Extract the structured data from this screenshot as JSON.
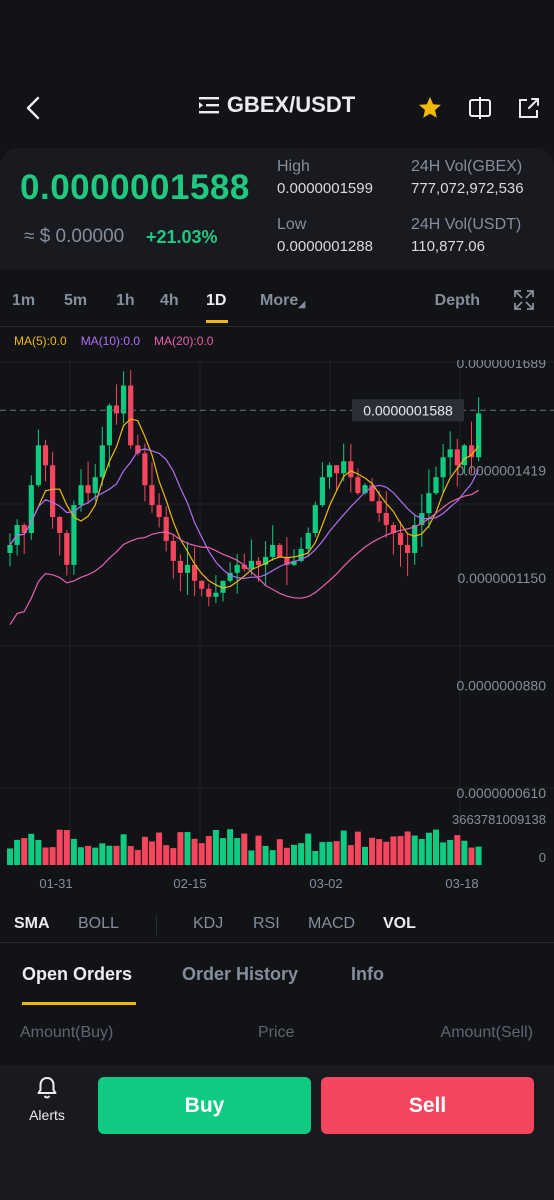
{
  "header": {
    "pair": "GBEX/USDT",
    "icons": [
      "back-arrow-icon",
      "list-icon",
      "star-icon",
      "split-icon",
      "share-icon"
    ],
    "star_color": "#f0b90b"
  },
  "summary": {
    "price": "0.0000001588",
    "usd_value": "≈ $ 0.00000",
    "change": "+21.03%",
    "high_label": "High",
    "high_value": "0.0000001599",
    "low_label": "Low",
    "low_value": "0.0000001288",
    "vol_base_label": "24H Vol(GBEX)",
    "vol_base_value": "777,072,972,536",
    "vol_quote_label": "24H Vol(USDT)",
    "vol_quote_value": "110,877.06"
  },
  "intervals": {
    "items": [
      "1m",
      "5m",
      "1h",
      "4h",
      "1D",
      "More"
    ],
    "active": "1D",
    "depth": "Depth"
  },
  "ma": {
    "ma5": "MA(5):0.0",
    "ma10": "MA(10):0.0",
    "ma20": "MA(20):0.0"
  },
  "chart_data": {
    "type": "candlestick",
    "price_axis_labels": [
      "0.0000001689",
      "0.0000001419",
      "0.0000001150",
      "0.0000000880",
      "0.0000000610"
    ],
    "price_axis_values": [
      1.689e-07,
      1.419e-07,
      1.15e-07,
      8.8e-08,
      6.1e-08
    ],
    "current_price_label": "0.0000001588",
    "volume_axis_labels": [
      "3663781009138",
      "0"
    ],
    "x_labels": [
      "01-31",
      "02-15",
      "03-02",
      "03-18"
    ],
    "colors": {
      "up": "#0ecb81",
      "down": "#f6465d",
      "ma5": "#f0b90b",
      "ma10": "#b26df4",
      "ma20": "#e85fb0"
    }
  },
  "indicators": {
    "items": [
      "SMA",
      "BOLL",
      "KDJ",
      "RSI",
      "MACD",
      "VOL"
    ],
    "active": [
      "SMA",
      "VOL"
    ]
  },
  "tabs": {
    "items": [
      "Open Orders",
      "Order History",
      "Info"
    ],
    "active": "Open Orders"
  },
  "orderbook_cols": {
    "buy": "Amount(Buy)",
    "price": "Price",
    "sell": "Amount(Sell)"
  },
  "bottom": {
    "alerts": "Alerts",
    "buy": "Buy",
    "sell": "Sell"
  }
}
